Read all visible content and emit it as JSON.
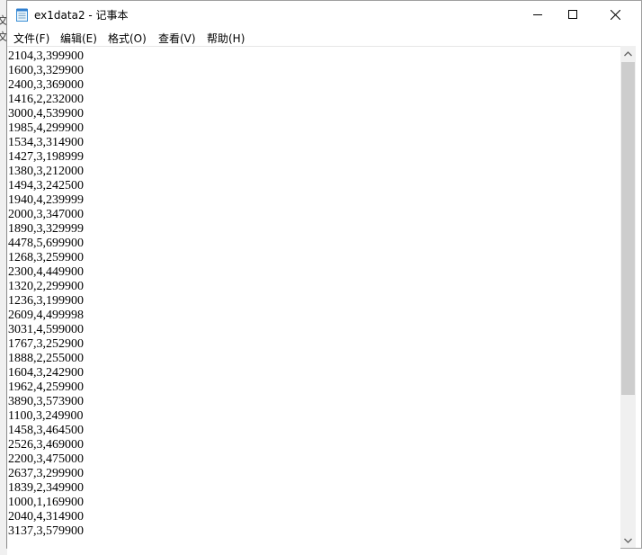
{
  "window": {
    "title": "ex1data2 - 记事本",
    "icon": "notepad-icon",
    "controls": [
      "minimize-icon",
      "maximize-icon",
      "close-icon"
    ]
  },
  "menu": {
    "items": [
      {
        "label": "文件(F)"
      },
      {
        "label": "编辑(E)"
      },
      {
        "label": "格式(O)"
      },
      {
        "label": "查看(V)"
      },
      {
        "label": "帮助(H)"
      }
    ]
  },
  "desktop_peek": [
    "文",
    "文"
  ],
  "editor": {
    "lines": [
      "2104,3,399900",
      "1600,3,329900",
      "2400,3,369000",
      "1416,2,232000",
      "3000,4,539900",
      "1985,4,299900",
      "1534,3,314900",
      "1427,3,198999",
      "1380,3,212000",
      "1494,3,242500",
      "1940,4,239999",
      "2000,3,347000",
      "1890,3,329999",
      "4478,5,699900",
      "1268,3,259900",
      "2300,4,449900",
      "1320,2,299900",
      "1236,3,199900",
      "2609,4,499998",
      "3031,4,599000",
      "1767,3,252900",
      "1888,2,255000",
      "1604,3,242900",
      "1962,4,259900",
      "3890,3,573900",
      "1100,3,249900",
      "1458,3,464500",
      "2526,3,469000",
      "2200,3,475000",
      "2637,3,299900",
      "1839,2,349900",
      "1000,1,169900",
      "2040,4,314900",
      "3137,3,579900"
    ]
  },
  "scrollbar": {
    "icons": [
      "scroll-up-icon",
      "scroll-down-icon"
    ]
  }
}
